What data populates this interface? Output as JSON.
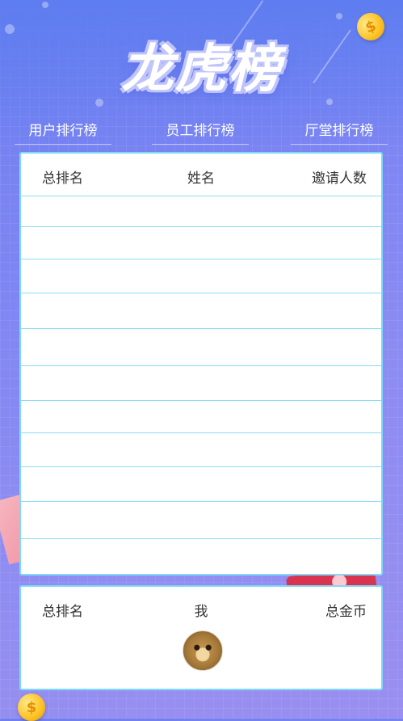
{
  "title": "龙虎榜",
  "tabs": [
    {
      "label": "用户排行榜"
    },
    {
      "label": "员工排行榜"
    },
    {
      "label": "厅堂排行榜"
    }
  ],
  "ranking_table": {
    "columns": [
      "总排名",
      "姓名",
      "邀请人数"
    ],
    "rows": []
  },
  "my_rank": {
    "columns": [
      "总排名",
      "我",
      "总金币"
    ]
  },
  "icons": {
    "coin": "coin-icon",
    "avatar": "cat-avatar"
  },
  "colors": {
    "accent_border": "#7fd9f5",
    "background_start": "#6f7ff0",
    "background_end": "#9a8ff0"
  }
}
